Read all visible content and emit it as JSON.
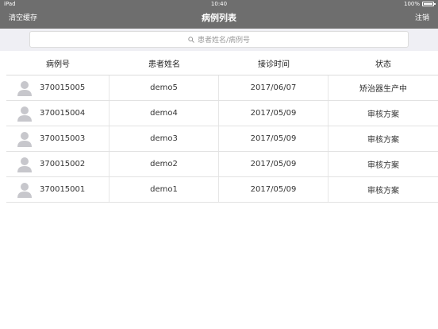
{
  "status_bar": {
    "device": "iPad",
    "time": "10:40",
    "battery": "100%",
    "battery_level": 1.0
  },
  "nav": {
    "left_label": "清空缓存",
    "title": "病例列表",
    "right_label": "注销"
  },
  "search": {
    "placeholder": "患者姓名/病例号"
  },
  "table": {
    "headers": [
      "病例号",
      "患者姓名",
      "接诊时间",
      "状态"
    ],
    "rows": [
      {
        "case_id": "370015005",
        "name": "demo5",
        "date": "2017/06/07",
        "status": "矫治器生产中"
      },
      {
        "case_id": "370015004",
        "name": "demo4",
        "date": "2017/05/09",
        "status": "审核方案"
      },
      {
        "case_id": "370015003",
        "name": "demo3",
        "date": "2017/05/09",
        "status": "审核方案"
      },
      {
        "case_id": "370015002",
        "name": "demo2",
        "date": "2017/05/09",
        "status": "审核方案"
      },
      {
        "case_id": "370015001",
        "name": "demo1",
        "date": "2017/05/09",
        "status": "审核方案"
      }
    ]
  },
  "colors": {
    "nav_bg": "#6e6e6e",
    "search_bg": "#efeff4",
    "avatar": "#c7c7cc"
  },
  "icons": {
    "search": "search-icon",
    "avatar": "person-avatar-icon",
    "battery": "battery-icon"
  }
}
